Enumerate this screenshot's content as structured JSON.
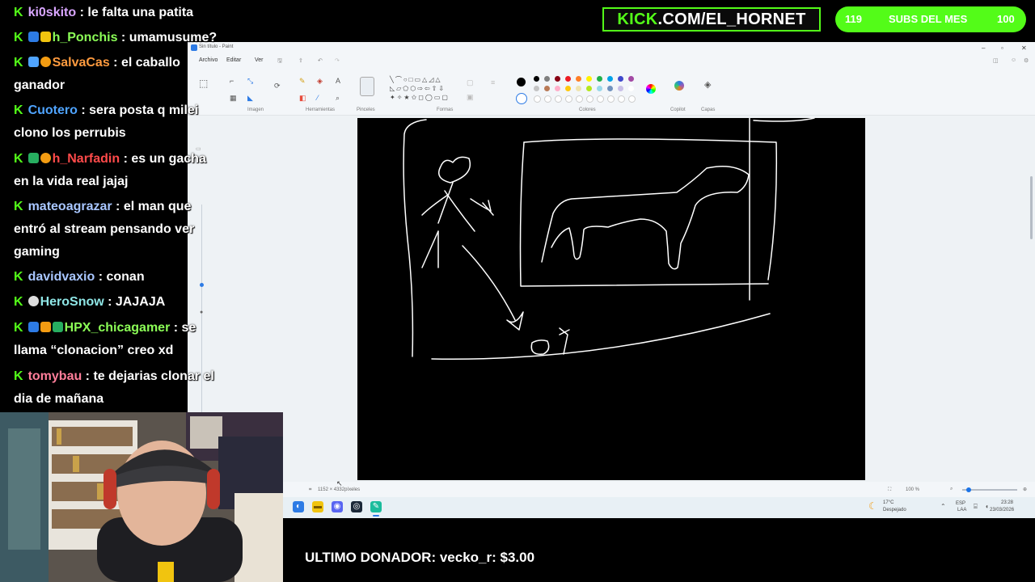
{
  "chat": [
    {
      "user": "ki0skito",
      "message": "le falta una patita",
      "color": "#d9a6ff"
    },
    {
      "user": "h_Ponchis",
      "message": "umamusume?",
      "color": "#8cff57"
    },
    {
      "user": "SalvaCas",
      "message": "el caballo",
      "message2": "ganador",
      "color": "#ff9b3f"
    },
    {
      "user": "Cuotero",
      "message": "sera posta q milei",
      "message2": "clono los perrubis",
      "color": "#4fa4ff"
    },
    {
      "user": "h_Narfadin",
      "message": "es un gacha",
      "message2": "en la vida real jajaj",
      "color": "#ff4a4a"
    },
    {
      "user": "mateoagrazar",
      "message": "el man que",
      "message2": "entró al stream pensando ver",
      "message3": "gaming",
      "color": "#a8c6ff"
    },
    {
      "user": "davidvaxio",
      "message": "conan",
      "color": "#a8c6ff"
    },
    {
      "user": "HeroSnow",
      "message": "JAJAJA",
      "color": "#8fe6e6"
    },
    {
      "user": "HPX_chicagamer",
      "message": "se",
      "message2": "llama “clonacion” creo xd",
      "color": "#8cff57"
    },
    {
      "user": "tomybau",
      "message": "te dejarias clonar el",
      "message2": "dia de mañana",
      "color": "#ff7e9a"
    }
  ],
  "kick_banner": {
    "prefix": "KICK",
    "rest": ".COM/EL_HORNET"
  },
  "subs": {
    "current": "119",
    "label": "SUBS DEL MES",
    "goal": "100"
  },
  "donor": {
    "label": "ULTIMO DONADOR:",
    "name": "vecko_r: $3.00"
  },
  "paint": {
    "title": "Sin título - Paint",
    "menu": [
      "Archivo",
      "Editar",
      "Ver"
    ],
    "groups": [
      "Imagen",
      "Herramientas",
      "Pinceles",
      "Formas",
      "Colores",
      "Copilot",
      "Capas"
    ],
    "status_size": "1152 × 4332píxeles",
    "zoom": "100 %"
  },
  "taskbar": {
    "weather_temp": "17°C",
    "weather_desc": "Despejado",
    "lang_1": "ESP",
    "lang_2": "LAA",
    "time": "23:28",
    "date": "23/03/2026"
  },
  "colors": {
    "kick_green": "#53fc18"
  }
}
